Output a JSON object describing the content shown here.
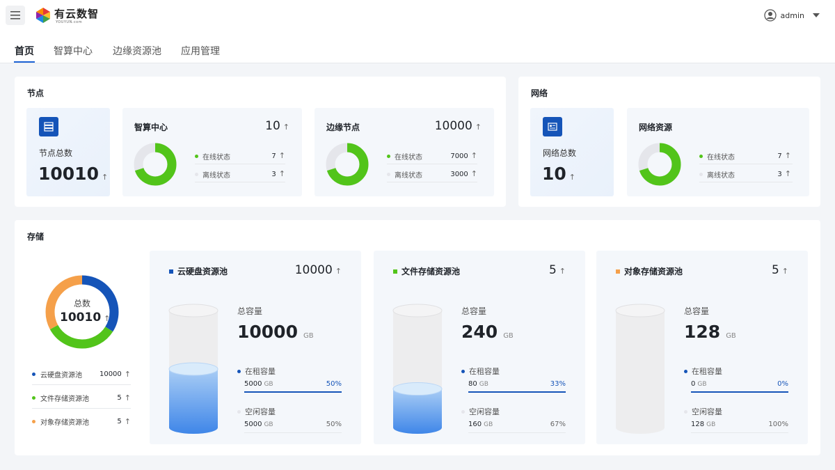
{
  "header": {
    "brand": "有云数智",
    "brand_sub": "YOUYUN.com",
    "user": "admin"
  },
  "tabs": [
    {
      "label": "首页",
      "active": true
    },
    {
      "label": "智算中心",
      "active": false
    },
    {
      "label": "边缘资源池",
      "active": false
    },
    {
      "label": "应用管理",
      "active": false
    }
  ],
  "colors": {
    "primary": "#1554b8",
    "online": "#52c41a",
    "offline": "#e5e6eb",
    "file": "#52c41a",
    "object": "#f5a04a"
  },
  "nodes": {
    "title": "节点",
    "total": {
      "label": "节点总数",
      "value": "10010",
      "arrow": "↑"
    },
    "compute": {
      "title": "智算中心",
      "value": "10",
      "arrow": "↑",
      "online_label": "在线状态",
      "online_value": "7",
      "offline_label": "离线状态",
      "offline_value": "3",
      "online_ratio": 0.7
    },
    "edge": {
      "title": "边缘节点",
      "value": "10000",
      "arrow": "↑",
      "online_label": "在线状态",
      "online_value": "7000",
      "offline_label": "离线状态",
      "offline_value": "3000",
      "online_ratio": 0.7
    }
  },
  "network": {
    "title": "网络",
    "total": {
      "label": "网络总数",
      "value": "10",
      "arrow": "↑"
    },
    "resource": {
      "title": "网络资源",
      "online_label": "在线状态",
      "online_value": "7",
      "offline_label": "离线状态",
      "offline_value": "3",
      "online_ratio": 0.7
    }
  },
  "storage": {
    "title": "存储",
    "total_label": "总数",
    "total_value": "10010",
    "arrow": "↑",
    "legend": [
      {
        "label": "云硬盘资源池",
        "value": "10000",
        "color": "#1554b8"
      },
      {
        "label": "文件存储资源池",
        "value": "5",
        "color": "#52c41a"
      },
      {
        "label": "对象存储资源池",
        "value": "5",
        "color": "#f5a04a"
      }
    ],
    "ring_shares": [
      0.34,
      0.33,
      0.33
    ],
    "pools": [
      {
        "title": "云硬盘资源池",
        "color": "#1554b8",
        "count": "10000",
        "cap_label": "总容量",
        "cap_value": "10000",
        "unit": "GB",
        "rented_label": "在租容量",
        "rented_value": "5000",
        "rented_pct": "50%",
        "rented_ratio": 0.5,
        "free_label": "空闲容量",
        "free_value": "5000",
        "free_pct": "50%"
      },
      {
        "title": "文件存储资源池",
        "color": "#52c41a",
        "count": "5",
        "cap_label": "总容量",
        "cap_value": "240",
        "unit": "GB",
        "rented_label": "在租容量",
        "rented_value": "80",
        "rented_pct": "33%",
        "rented_ratio": 0.33,
        "free_label": "空闲容量",
        "free_value": "160",
        "free_pct": "67%"
      },
      {
        "title": "对象存储资源池",
        "color": "#f5a04a",
        "count": "5",
        "cap_label": "总容量",
        "cap_value": "128",
        "unit": "GB",
        "rented_label": "在租容量",
        "rented_value": "0",
        "rented_pct": "0%",
        "rented_ratio": 0,
        "free_label": "空闲容量",
        "free_value": "128",
        "free_pct": "100%"
      }
    ]
  }
}
